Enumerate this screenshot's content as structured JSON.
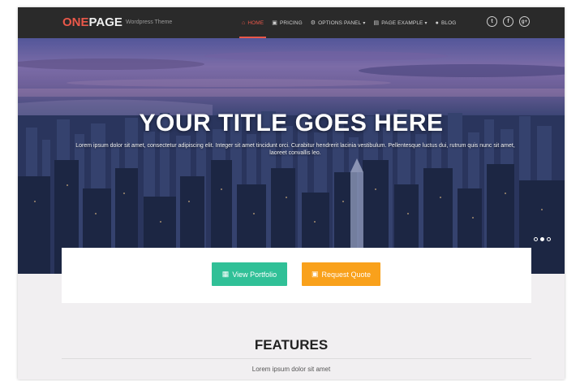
{
  "header": {
    "logo_part1": "ONE",
    "logo_part2": "PAGE",
    "tagline": "Wordpress Theme"
  },
  "nav": {
    "items": [
      {
        "label": "HOME",
        "icon": "home-icon",
        "active": true
      },
      {
        "label": "PRICING",
        "icon": "cart-icon"
      },
      {
        "label": "OPTIONS PANEL",
        "icon": "cogs-icon",
        "dropdown": true
      },
      {
        "label": "PAGE EXAMPLE",
        "icon": "file-icon",
        "dropdown": true
      },
      {
        "label": "BLOG",
        "icon": "comment-icon"
      }
    ],
    "social": [
      {
        "name": "twitter-icon",
        "glyph": "t"
      },
      {
        "name": "facebook-icon",
        "glyph": "f"
      },
      {
        "name": "google-plus-icon",
        "glyph": "g+"
      }
    ]
  },
  "hero": {
    "title": "YOUR TITLE GOES HERE",
    "text": "Lorem ipsum dolor sit amet, consectetur adipiscing elit. Integer sit amet tincidunt orci. Curabitur hendrerit lacinia vestibulum. Pellentesque luctus dui, rutrum quis nunc sit amet, laoreet convallis leo.",
    "slides_total": 3,
    "slide_active": 2
  },
  "cta": {
    "portfolio_label": "View Portfolio",
    "quote_label": "Request Quote"
  },
  "features": {
    "title": "FEATURES",
    "subtitle": "Lorem ipsum dolor sit amet"
  },
  "colors": {
    "accent": "#e9584a",
    "portfolio_button": "#30c097",
    "quote_button": "#f9a11b",
    "navbar": "#2a2a2a"
  }
}
